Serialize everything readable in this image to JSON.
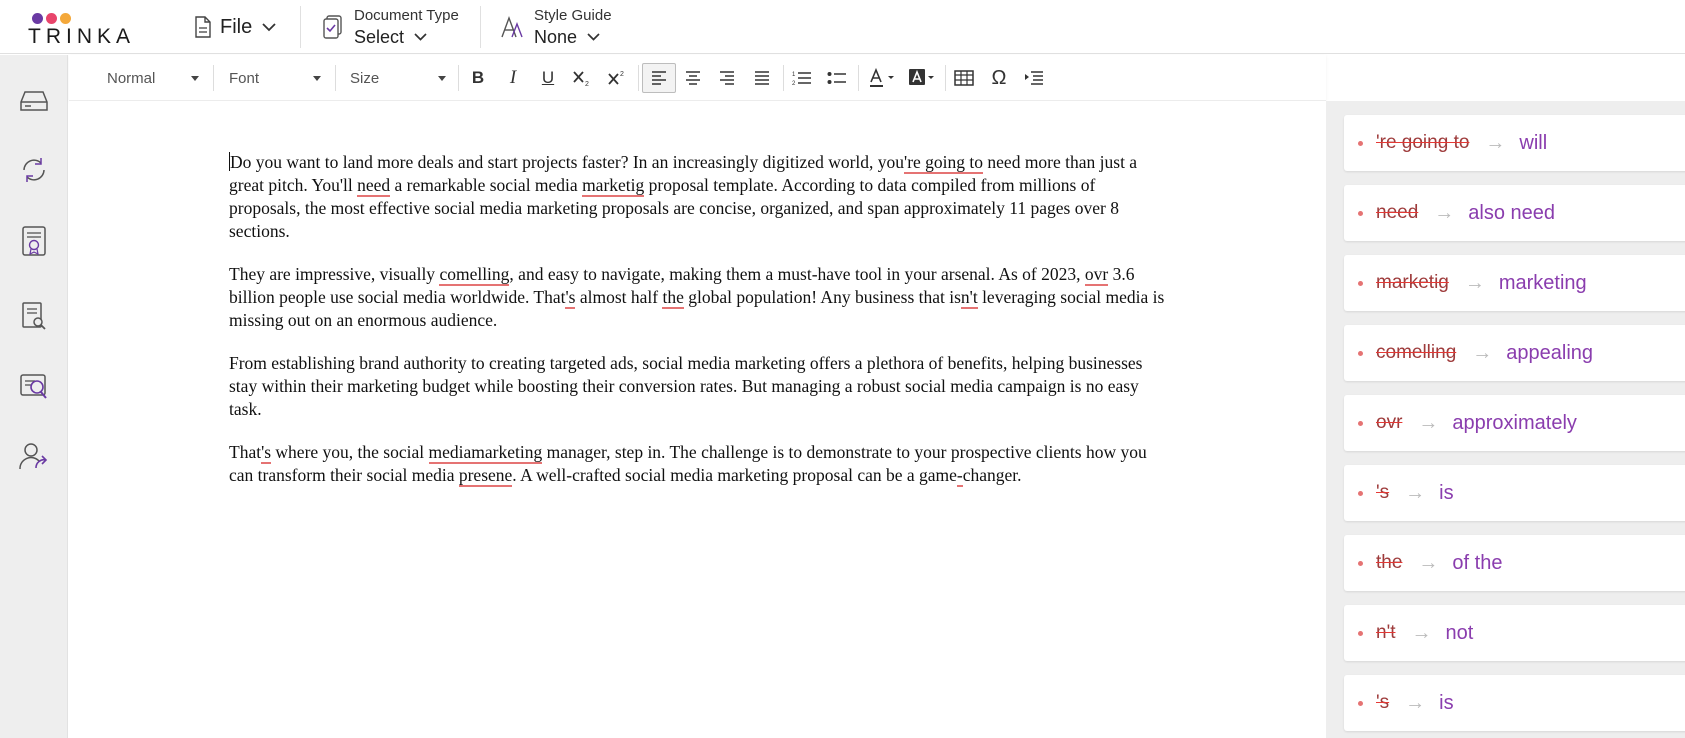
{
  "brand": {
    "name": "TRINKA",
    "dot_colors": [
      "#6a3aa3",
      "#e8456b",
      "#f4a83a"
    ]
  },
  "topbar": {
    "file_label": "File",
    "document_type": {
      "label": "Document Type",
      "value": "Select"
    },
    "style_guide": {
      "label": "Style Guide",
      "value": "None"
    }
  },
  "sidebar": {
    "items": [
      {
        "icon": "drive-icon"
      },
      {
        "icon": "sync-icon"
      },
      {
        "icon": "certificate-icon"
      },
      {
        "icon": "document-search-icon"
      },
      {
        "icon": "plagiarism-check-icon"
      },
      {
        "icon": "user-share-icon"
      }
    ]
  },
  "toolbar": {
    "paragraph_style": "Normal",
    "font": "Font",
    "size": "Size",
    "bold": "B",
    "italic": "I",
    "underline": "U",
    "special_char": "Ω"
  },
  "document": {
    "paragraphs": [
      [
        {
          "t": "Do you want to land more deals and start projects faster? In an increasingly digitized world, you"
        },
        {
          "t": "'re going to",
          "err": true
        },
        {
          "t": " need more than just a great pitch. You'll "
        },
        {
          "t": "need",
          "err": true
        },
        {
          "t": " a remarkable social media "
        },
        {
          "t": "marketig",
          "err": true
        },
        {
          "t": " proposal template. According to data compiled from millions of proposals, the most effective social media marketing proposals are concise, organized, and span approximately 11 pages over 8 sections."
        }
      ],
      [
        {
          "t": "They are impressive, visually "
        },
        {
          "t": "comelling",
          "err": true
        },
        {
          "t": ", and easy to navigate, making them a must-have tool in your arsenal. As of 2023, "
        },
        {
          "t": "ovr",
          "err": true
        },
        {
          "t": " 3.6 billion people use social media worldwide. That"
        },
        {
          "t": "'s",
          "err": true
        },
        {
          "t": " almost half "
        },
        {
          "t": "the",
          "err": true
        },
        {
          "t": " global population! Any business that is"
        },
        {
          "t": "n't",
          "err": true
        },
        {
          "t": " leveraging social media is missing out on an enormous audience."
        }
      ],
      [
        {
          "t": "From establishing brand authority to creating targeted ads, social media marketing offers a plethora of benefits, helping businesses stay within their marketing budget while boosting their conversion rates. But managing a robust social media campaign is no easy task."
        }
      ],
      [
        {
          "t": "That"
        },
        {
          "t": "'s",
          "err": true
        },
        {
          "t": " where you, the social "
        },
        {
          "t": "mediamarketing",
          "err": true
        },
        {
          "t": " manager, step in. The challenge is to demonstrate to your prospective clients how you can transform their social media "
        },
        {
          "t": "presene",
          "err": true
        },
        {
          "t": ". A well-crafted social media marketing proposal can be a game"
        },
        {
          "t": "-",
          "err": true
        },
        {
          "t": "changer."
        }
      ]
    ]
  },
  "suggestions": [
    {
      "original": "'re going to",
      "suggestion": "will"
    },
    {
      "original": "need",
      "suggestion": "also need"
    },
    {
      "original": "marketig",
      "suggestion": "marketing"
    },
    {
      "original": "comelling",
      "suggestion": "appealing"
    },
    {
      "original": "ovr",
      "suggestion": "approximately"
    },
    {
      "original": "'s",
      "suggestion": "is"
    },
    {
      "original": "the",
      "suggestion": "of the"
    },
    {
      "original": "n't",
      "suggestion": "not"
    },
    {
      "original": "'s",
      "suggestion": "is"
    }
  ],
  "colors": {
    "accent_purple": "#8a3dae",
    "error_red": "#e57373"
  }
}
